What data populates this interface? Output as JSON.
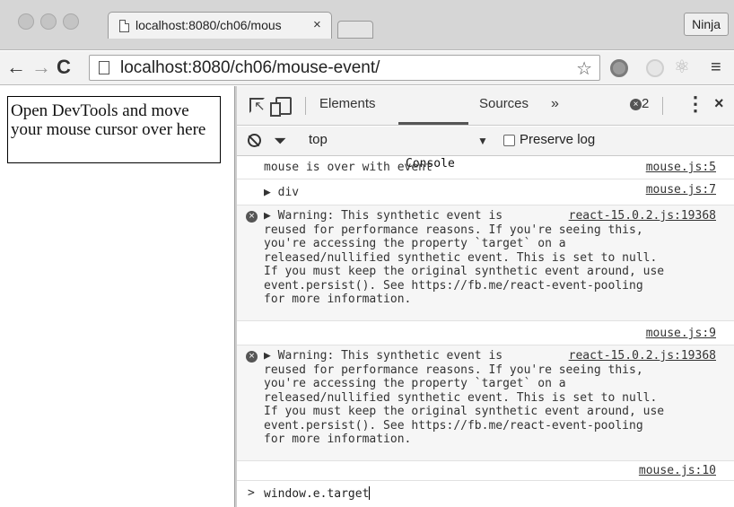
{
  "browser": {
    "tab_title": "localhost:8080/ch06/mous",
    "tab_close": "×",
    "profile_name": "Ninja",
    "back": "←",
    "forward": "→",
    "reload": "C",
    "url": "localhost:8080/ch06/mouse-event/",
    "star": "☆",
    "menu": "≡",
    "ext3": "⚛"
  },
  "page": {
    "target_text": "Open DevTools and move your mouse cursor over here"
  },
  "devtools": {
    "tabs": {
      "elements": "Elements",
      "console": "Console",
      "sources": "Sources",
      "more": "»"
    },
    "error_count": "2",
    "error_glyph": "×",
    "kebab": "⋮",
    "close": "×",
    "filter": {
      "context": "top",
      "context_arrow": "▼",
      "preserve_log": "Preserve log"
    },
    "console": {
      "rows": [
        {
          "message": "mouse is over with event",
          "source": "mouse.js:5"
        },
        {
          "message": "▶ div",
          "source": "mouse.js:7"
        },
        {
          "message": "▶ Warning: This synthetic event is\nreused for performance reasons. If you're seeing this,\nyou're accessing the property `target` on a\nreleased/nullified synthetic event. This is set to null.\nIf you must keep the original synthetic event around, use\nevent.persist(). See https://fb.me/react-event-pooling\nfor more information.",
          "source": "react-15.0.2.js:19368"
        },
        {
          "message": "",
          "source": "mouse.js:9"
        },
        {
          "message": "▶ Warning: This synthetic event is\nreused for performance reasons. If you're seeing this,\nyou're accessing the property `target` on a\nreleased/nullified synthetic event. This is set to null.\nIf you must keep the original synthetic event around, use\nevent.persist(). See https://fb.me/react-event-pooling\nfor more information.",
          "source": "react-15.0.2.js:19368"
        },
        {
          "message": "",
          "source": "mouse.js:10"
        }
      ],
      "prompt_caret": ">",
      "input": "window.e.target"
    }
  }
}
